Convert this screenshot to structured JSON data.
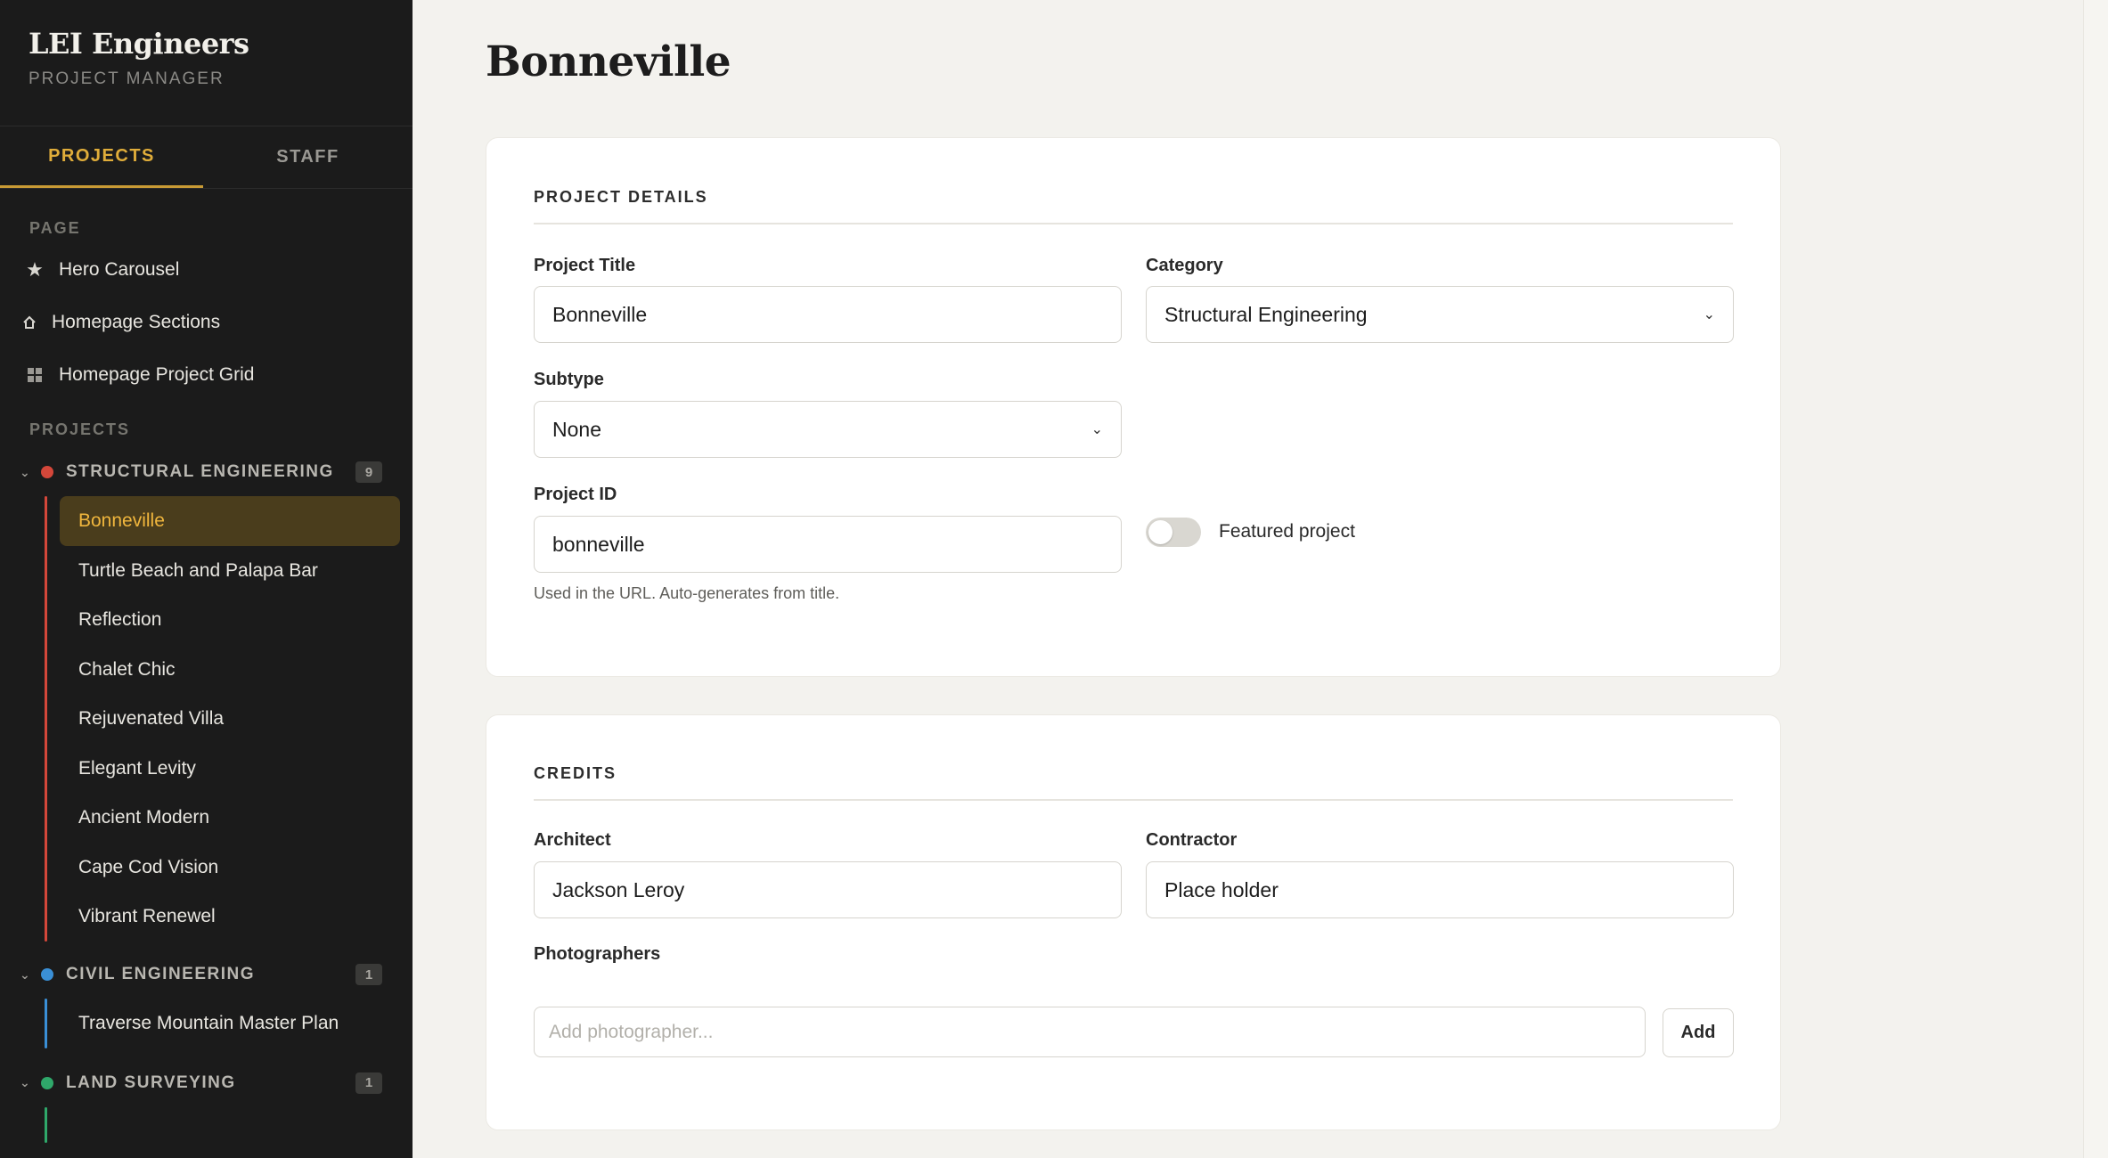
{
  "brand": {
    "title": "LEI Engineers",
    "subtitle": "PROJECT MANAGER"
  },
  "tabs": [
    {
      "label": "PROJECTS",
      "active": true
    },
    {
      "label": "STAFF",
      "active": false
    }
  ],
  "sidebar": {
    "page_label": "PAGE",
    "page_items": [
      {
        "label": "Hero Carousel",
        "icon": "star-icon"
      },
      {
        "label": "Homepage Sections",
        "icon": "home-icon"
      },
      {
        "label": "Homepage Project Grid",
        "icon": "grid-icon"
      }
    ],
    "projects_label": "PROJECTS",
    "groups": [
      {
        "name": "STRUCTURAL ENGINEERING",
        "count": "9",
        "color": "#d4473a",
        "items": [
          "Bonneville",
          "Turtle Beach and Palapa Bar",
          "Reflection",
          "Chalet Chic",
          "Rejuvenated Villa",
          "Elegant Levity",
          "Ancient Modern",
          "Cape Cod Vision",
          "Vibrant Renewel"
        ],
        "active_item": "Bonneville"
      },
      {
        "name": "CIVIL ENGINEERING",
        "count": "1",
        "color": "#3a8fd6",
        "items": [
          "Traverse Mountain Master Plan"
        ]
      },
      {
        "name": "LAND SURVEYING",
        "count": "1",
        "color": "#2fa86a",
        "items": []
      }
    ]
  },
  "main": {
    "title": "Bonneville",
    "details": {
      "section_title": "PROJECT DETAILS",
      "project_title_label": "Project Title",
      "project_title_value": "Bonneville",
      "category_label": "Category",
      "category_value": "Structural Engineering",
      "subtype_label": "Subtype",
      "subtype_value": "None",
      "project_id_label": "Project ID",
      "project_id_value": "bonneville",
      "project_id_hint": "Used in the URL. Auto-generates from title.",
      "featured_label": "Featured project",
      "featured_on": false
    },
    "credits": {
      "section_title": "CREDITS",
      "architect_label": "Architect",
      "architect_value": "Jackson Leroy",
      "contractor_label": "Contractor",
      "contractor_value": "Place holder",
      "photographers_label": "Photographers",
      "photographer_placeholder": "Add photographer...",
      "add_button": "Add"
    }
  },
  "colors": {
    "accent": "#e0ad3a",
    "sidebar_bg": "#1b1b1b",
    "page_bg": "#f3f2ee"
  }
}
